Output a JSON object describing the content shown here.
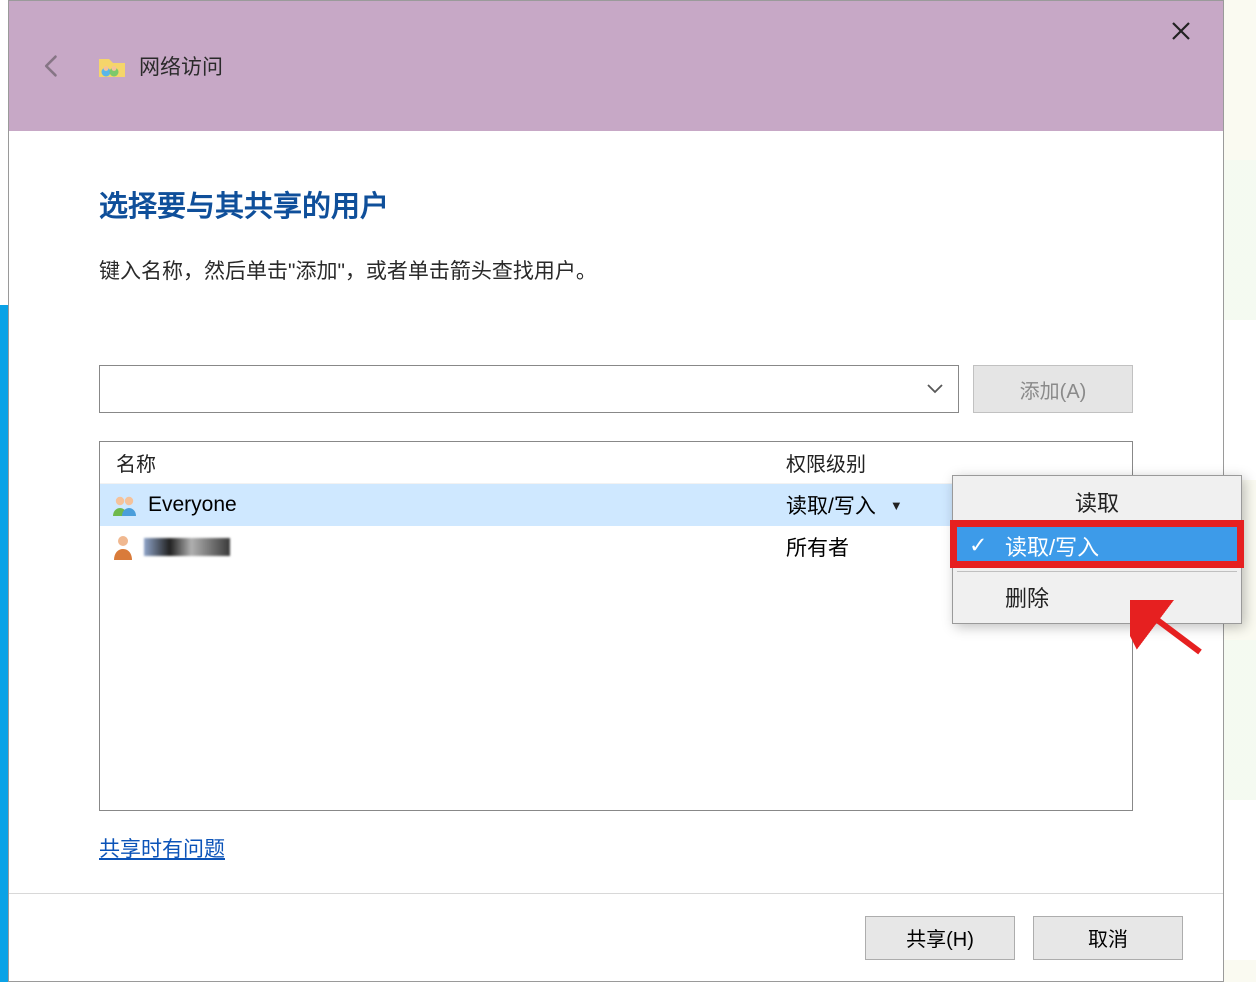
{
  "titlebar": {
    "title": "网络访问"
  },
  "heading": "选择要与其共享的用户",
  "instruction": "键入名称，然后单击\"添加\"，或者单击箭头查找用户。",
  "combo": {
    "value": ""
  },
  "buttons": {
    "add": "添加(A)",
    "share": "共享(H)",
    "cancel": "取消"
  },
  "table": {
    "columns": {
      "name": "名称",
      "perm": "权限级别"
    },
    "rows": [
      {
        "name": "Everyone",
        "perm": "读取/写入",
        "selected": true,
        "has_dropdown": true,
        "icon": "people"
      },
      {
        "name_hidden": true,
        "perm": "所有者",
        "selected": false,
        "has_dropdown": false,
        "icon": "person"
      }
    ]
  },
  "help_link": "共享时有问题",
  "context_menu": {
    "items": [
      {
        "label": "读取",
        "selected": false
      },
      {
        "label": "读取/写入",
        "selected": true
      }
    ],
    "separator_after": 1,
    "tail": [
      {
        "label": "删除",
        "selected": false
      }
    ]
  }
}
